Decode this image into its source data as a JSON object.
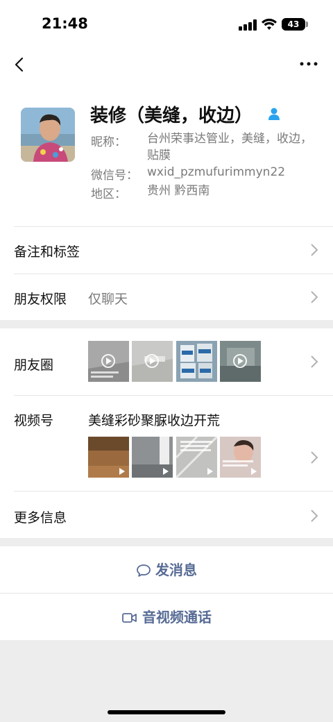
{
  "status": {
    "time": "21:48",
    "battery": "43"
  },
  "profile": {
    "name": "装修（美缝，收边）",
    "nickname_label": "昵称：",
    "nickname": "台州荣事达管业，美缝，收边，贴膜",
    "wechat_id_label": "微信号：",
    "wechat_id": "wxid_pzmufurimmyn22",
    "region_label": "地区：",
    "region": "贵州 黔西南"
  },
  "rows": {
    "remarks_tags": "备注和标签",
    "friend_permissions": "朋友权限",
    "friend_permissions_value": "仅聊天",
    "moments": "朋友圈",
    "channels": "视频号",
    "channels_title": "美缝彩砂聚脲收边开荒",
    "more_info": "更多信息"
  },
  "actions": {
    "send_message": "发消息",
    "video_call": "音视频通话"
  },
  "colors": {
    "link_blue": "#576b95",
    "background": "#ededed",
    "verified_blue": "#2aa3ee"
  }
}
